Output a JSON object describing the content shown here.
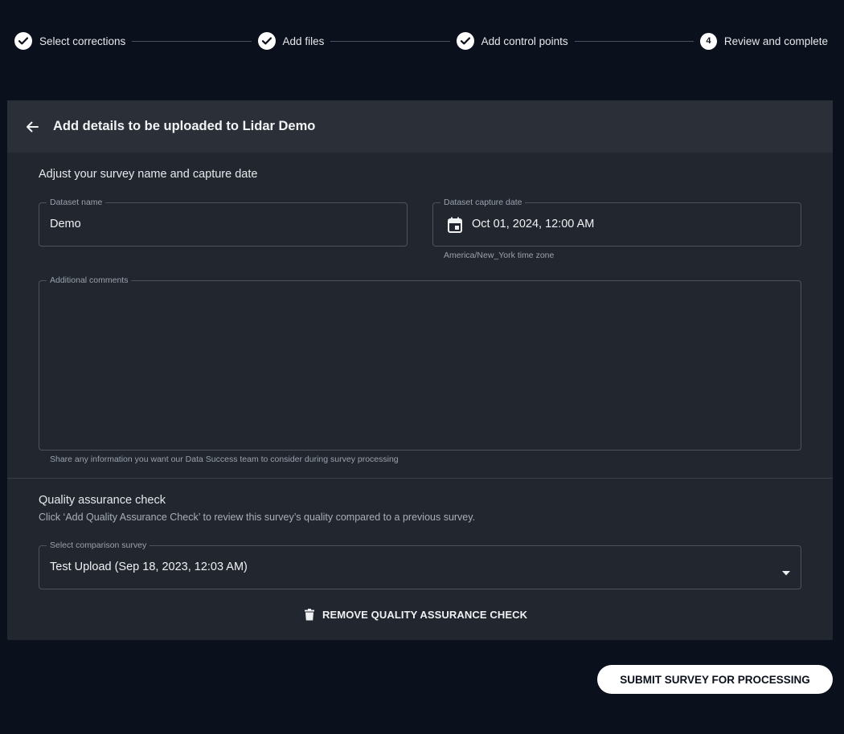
{
  "stepper": {
    "steps": [
      {
        "label": "Select corrections",
        "status": "complete"
      },
      {
        "label": "Add files",
        "status": "complete"
      },
      {
        "label": "Add control points",
        "status": "complete"
      },
      {
        "label": "Review and complete",
        "status": "current",
        "number": "4"
      }
    ]
  },
  "header": {
    "title": "Add details to be uploaded to Lidar Demo"
  },
  "details": {
    "section_title": "Adjust your survey name and capture date",
    "dataset_name_label": "Dataset name",
    "dataset_name_value": "Demo",
    "capture_date_label": "Dataset capture date",
    "capture_date_value": "Oct 01, 2024, 12:00 AM",
    "timezone_helper": "America/New_York time zone",
    "comments_label": "Additional comments",
    "comments_value": "",
    "comments_helper": "Share any information you want our Data Success team to consider during survey processing"
  },
  "quality": {
    "section_title": "Quality assurance check",
    "description": "Click ‘Add Quality Assurance Check’ to review this survey’s quality compared to a previous survey.",
    "comparison_label": "Select comparison survey",
    "comparison_value": "Test Upload (Sep 18, 2023, 12:03 AM)",
    "remove_label": "REMOVE QUALITY ASSURANCE CHECK"
  },
  "footer": {
    "submit_label": "SUBMIT SURVEY FOR PROCESSING"
  },
  "icons": {
    "step_complete": "check-circle-icon",
    "back": "arrow-left-icon",
    "calendar": "calendar-icon",
    "dropdown": "caret-down-icon",
    "remove": "trash-icon"
  },
  "colors": {
    "background": "#0b111c",
    "card": "#22272f",
    "card_header": "#2b3038",
    "accent": "#ffffff"
  }
}
